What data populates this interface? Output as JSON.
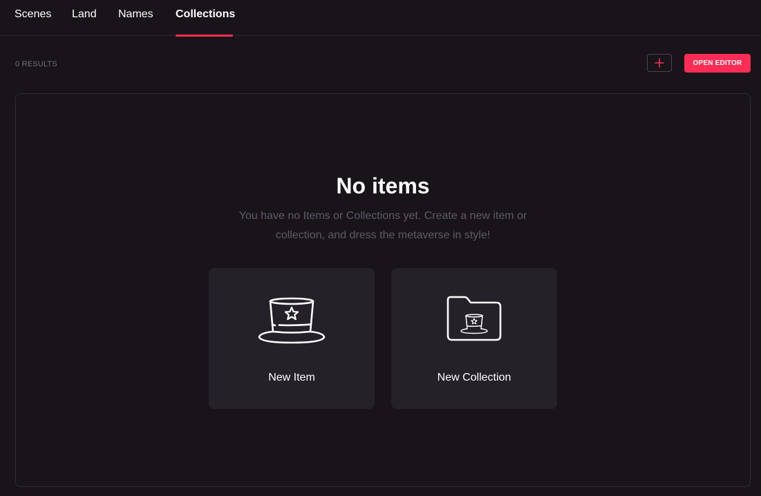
{
  "nav": {
    "tabs": [
      {
        "label": "Scenes",
        "active": false
      },
      {
        "label": "Land",
        "active": false
      },
      {
        "label": "Names",
        "active": false
      },
      {
        "label": "Collections",
        "active": true
      }
    ]
  },
  "toolbar": {
    "results_label": "0 RESULTS",
    "add_icon": "plus-icon",
    "open_editor_label": "OPEN EDITOR"
  },
  "empty_state": {
    "title": "No items",
    "description": "You have no Items or Collections yet. Create a new item or collection, and dress the metaverse in style!",
    "cards": [
      {
        "label": "New Item",
        "icon": "top-hat-icon"
      },
      {
        "label": "New Collection",
        "icon": "folder-hat-icon"
      }
    ]
  },
  "colors": {
    "background": "#18141a",
    "accent": "#ff2d55",
    "card": "#242129",
    "muted_text": "#736e7d"
  }
}
